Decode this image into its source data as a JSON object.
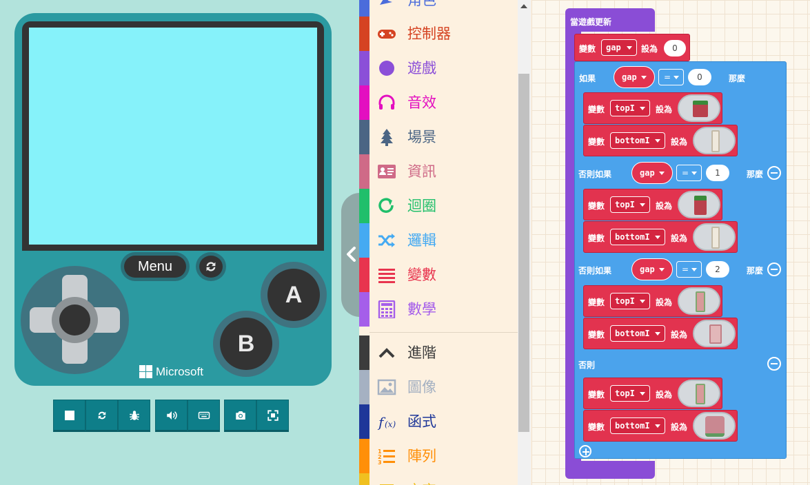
{
  "simulator": {
    "menu_label": "Menu",
    "a_label": "A",
    "b_label": "B",
    "brand": "Microsoft",
    "screen_color": "#86f2fa",
    "console_color": "#2b9aa1",
    "toolbar_icons": [
      "stop-icon",
      "restart-icon",
      "debug-icon",
      "sound-icon",
      "keyboard-icon",
      "screenshot-icon",
      "fullscreen-icon"
    ]
  },
  "toolbox": {
    "categories": [
      {
        "label": "角色",
        "icon": "sprites-icon",
        "color": "#4b6cdb"
      },
      {
        "label": "控制器",
        "icon": "gamepad-icon",
        "color": "#d54322"
      },
      {
        "label": "遊戲",
        "icon": "circle-icon",
        "color": "#8b4fd8"
      },
      {
        "label": "音效",
        "icon": "headphones-icon",
        "color": "#e30fc0"
      },
      {
        "label": "場景",
        "icon": "tree-icon",
        "color": "#4b6584"
      },
      {
        "label": "資訊",
        "icon": "id-card-icon",
        "color": "#cf6a87"
      },
      {
        "label": "迴圈",
        "icon": "loop-icon",
        "color": "#20bf6b"
      },
      {
        "label": "邏輯",
        "icon": "shuffle-icon",
        "color": "#45aaf2"
      },
      {
        "label": "變數",
        "icon": "list-icon",
        "color": "#e8344e"
      },
      {
        "label": "數學",
        "icon": "calculator-icon",
        "color": "#a55eea"
      },
      {
        "label": "進階",
        "icon": "chevron-up-icon",
        "color": "#3c3c3c"
      },
      {
        "label": "圖像",
        "icon": "image-icon",
        "color": "#a5b1c2"
      },
      {
        "label": "函式",
        "icon": "function-icon",
        "color": "#1e3799"
      },
      {
        "label": "陣列",
        "icon": "numbered-list-icon",
        "color": "#ff8f08"
      },
      {
        "label": "文字",
        "icon": "text-icon",
        "color": "#f0c020"
      }
    ]
  },
  "workspace": {
    "hat_label": "當遊戲更新",
    "set_label": "變數",
    "to_label": "設為",
    "if_label": "如果",
    "then_label": "那麼",
    "elseif_label": "否則如果",
    "else_label": "否則",
    "var_gap": "gap",
    "var_top": "topI",
    "var_bottom": "bottomI",
    "op_eq": "=",
    "init_value": "0",
    "cond_values": [
      "0",
      "1",
      "2"
    ]
  }
}
